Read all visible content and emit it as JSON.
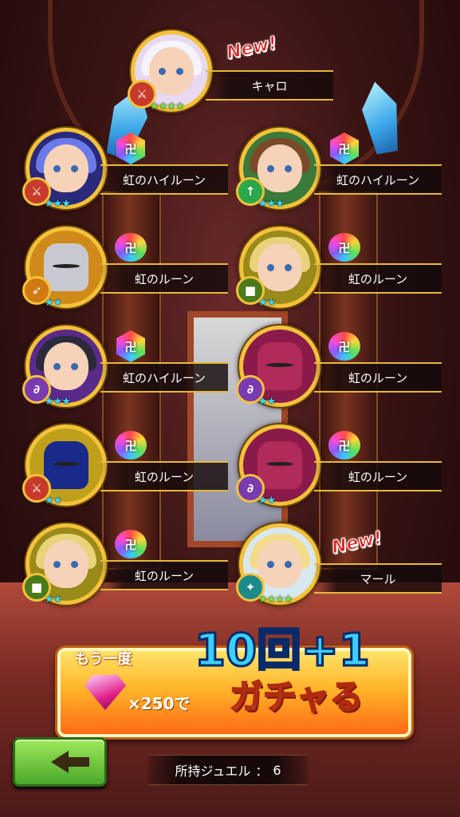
{
  "units": [
    {
      "id": "carol",
      "name": "キャロ",
      "new": true,
      "new_label": "New!",
      "stars": "★★★★",
      "weapon": "sword",
      "weapon_color": "#c83a2a",
      "frame": "#f3c23a",
      "rune": null
    },
    {
      "id": "u1",
      "name": "虹のハイルーン",
      "stars": "★★★",
      "weapon": "sword",
      "weapon_color": "#c83a2a",
      "rune": "hex",
      "rune_mark": "卍"
    },
    {
      "id": "u2",
      "name": "虹のハイルーン",
      "stars": "★★★",
      "weapon": "spear",
      "weapon_color": "#2aa84a",
      "rune": "hex",
      "rune_mark": "卍"
    },
    {
      "id": "u3",
      "name": "虹のルーン",
      "stars": "★★",
      "weapon": "bow",
      "weapon_color": "#d07a14",
      "rune": "drop",
      "rune_mark": "卍"
    },
    {
      "id": "u4",
      "name": "虹のルーン",
      "stars": "★★",
      "weapon": "hammer",
      "weapon_color": "#4a7a1a",
      "rune": "drop",
      "rune_mark": "卍"
    },
    {
      "id": "u5",
      "name": "虹のハイルーン",
      "stars": "★★★",
      "weapon": "staff",
      "weapon_color": "#7a3ab0",
      "rune": "hex",
      "rune_mark": "卍"
    },
    {
      "id": "u6",
      "name": "虹のルーン",
      "stars": "★★",
      "weapon": "staff",
      "weapon_color": "#7a3ab0",
      "rune": "drop",
      "rune_mark": "卍"
    },
    {
      "id": "u7",
      "name": "虹のルーン",
      "stars": "★★",
      "weapon": "sword",
      "weapon_color": "#c83a2a",
      "rune": "drop",
      "rune_mark": "卍"
    },
    {
      "id": "u8",
      "name": "虹のルーン",
      "stars": "★★",
      "weapon": "staff",
      "weapon_color": "#7a3ab0",
      "rune": "drop",
      "rune_mark": "卍"
    },
    {
      "id": "u9",
      "name": "虹のルーン",
      "stars": "★★",
      "weapon": "hammer",
      "weapon_color": "#4a7a1a",
      "rune": "drop",
      "rune_mark": "卍"
    },
    {
      "id": "marl",
      "name": "マール",
      "new": true,
      "new_label": "New!",
      "stars": "★★★★",
      "weapon": "hammer",
      "weapon_color": "#1a8a8a",
      "rune": null
    }
  ],
  "gacha": {
    "again": "もう一度",
    "count": "10回+1",
    "cost": "×250で",
    "label": "ガチャる",
    "gem_color": "#e0208a"
  },
  "footer": {
    "jewel_label": "所持ジュエル",
    "separator": "：",
    "jewel_count": "6",
    "back_icon": "back-arrow-icon"
  }
}
